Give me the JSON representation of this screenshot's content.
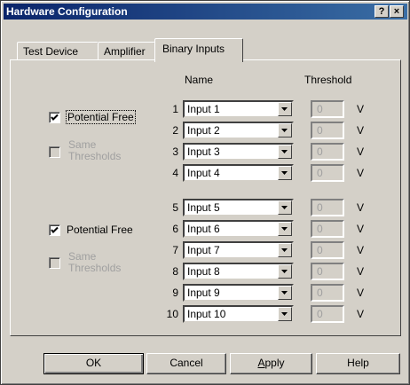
{
  "window": {
    "title": "Hardware Configuration",
    "help_label": "?",
    "close_label": "×"
  },
  "tabs": [
    {
      "label": "Test Device",
      "active": false
    },
    {
      "label": "Amplifier",
      "active": false
    },
    {
      "label": "Binary Inputs",
      "active": true
    }
  ],
  "headers": {
    "name": "Name",
    "threshold": "Threshold"
  },
  "groups": [
    {
      "potential_free": {
        "label": "Potential Free",
        "checked": true
      },
      "same_thresholds": {
        "line1": "Same",
        "line2": "Thresholds",
        "checked": false,
        "enabled": false
      }
    },
    {
      "potential_free": {
        "label": "Potential Free",
        "checked": true
      },
      "same_thresholds": {
        "line1": "Same",
        "line2": "Thresholds",
        "checked": false,
        "enabled": false
      }
    }
  ],
  "inputs": [
    {
      "number": "1",
      "name": "Input 1",
      "threshold": "0",
      "unit": "V"
    },
    {
      "number": "2",
      "name": "Input 2",
      "threshold": "0",
      "unit": "V"
    },
    {
      "number": "3",
      "name": "Input 3",
      "threshold": "0",
      "unit": "V"
    },
    {
      "number": "4",
      "name": "Input 4",
      "threshold": "0",
      "unit": "V"
    },
    {
      "number": "5",
      "name": "Input 5",
      "threshold": "0",
      "unit": "V"
    },
    {
      "number": "6",
      "name": "Input 6",
      "threshold": "0",
      "unit": "V"
    },
    {
      "number": "7",
      "name": "Input 7",
      "threshold": "0",
      "unit": "V"
    },
    {
      "number": "8",
      "name": "Input 8",
      "threshold": "0",
      "unit": "V"
    },
    {
      "number": "9",
      "name": "Input 9",
      "threshold": "0",
      "unit": "V"
    },
    {
      "number": "10",
      "name": "Input 10",
      "threshold": "0",
      "unit": "V"
    }
  ],
  "buttons": {
    "ok": "OK",
    "cancel": "Cancel",
    "apply": "Apply",
    "help": "Help"
  }
}
